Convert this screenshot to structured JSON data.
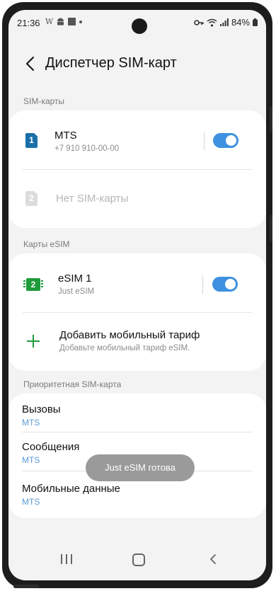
{
  "status_bar": {
    "time": "21:36",
    "left_icons": [
      "w-icon",
      "android-icon",
      "square-icon",
      "dot-icon"
    ],
    "right_icons": [
      "key-icon",
      "wifi-icon",
      "signal-icon"
    ],
    "battery": "84%"
  },
  "header": {
    "title": "Диспетчер SIM-карт"
  },
  "sim_section": {
    "label": "SIM-карты",
    "sim1": {
      "badge": "1",
      "name": "MTS",
      "number": "+7 910 910-00-00",
      "enabled": true
    },
    "sim2": {
      "badge": "2",
      "name": "Нет SIM-карты"
    }
  },
  "esim_section": {
    "label": "Карты eSIM",
    "esim1": {
      "badge": "2",
      "name": "eSIM 1",
      "carrier": "Just eSIM",
      "enabled": true
    },
    "add_plan": {
      "title": "Добавить мобильный тариф",
      "subtitle": "Добавьте мобильный тариф eSIM."
    }
  },
  "priority_section": {
    "label": "Приоритетная SIM-карта",
    "calls": {
      "title": "Вызовы",
      "value": "MTS"
    },
    "messages": {
      "title": "Сообщения",
      "value": "MTS"
    },
    "mobile_data": {
      "title": "Мобильные данные",
      "value": "MTS"
    }
  },
  "toast": {
    "text": "Just eSIM готова"
  },
  "colors": {
    "accent": "#3e91e0",
    "sim1_badge": "#1a6fa8",
    "esim_green": "#1e9b3a",
    "value_blue": "#5b9bd5"
  }
}
